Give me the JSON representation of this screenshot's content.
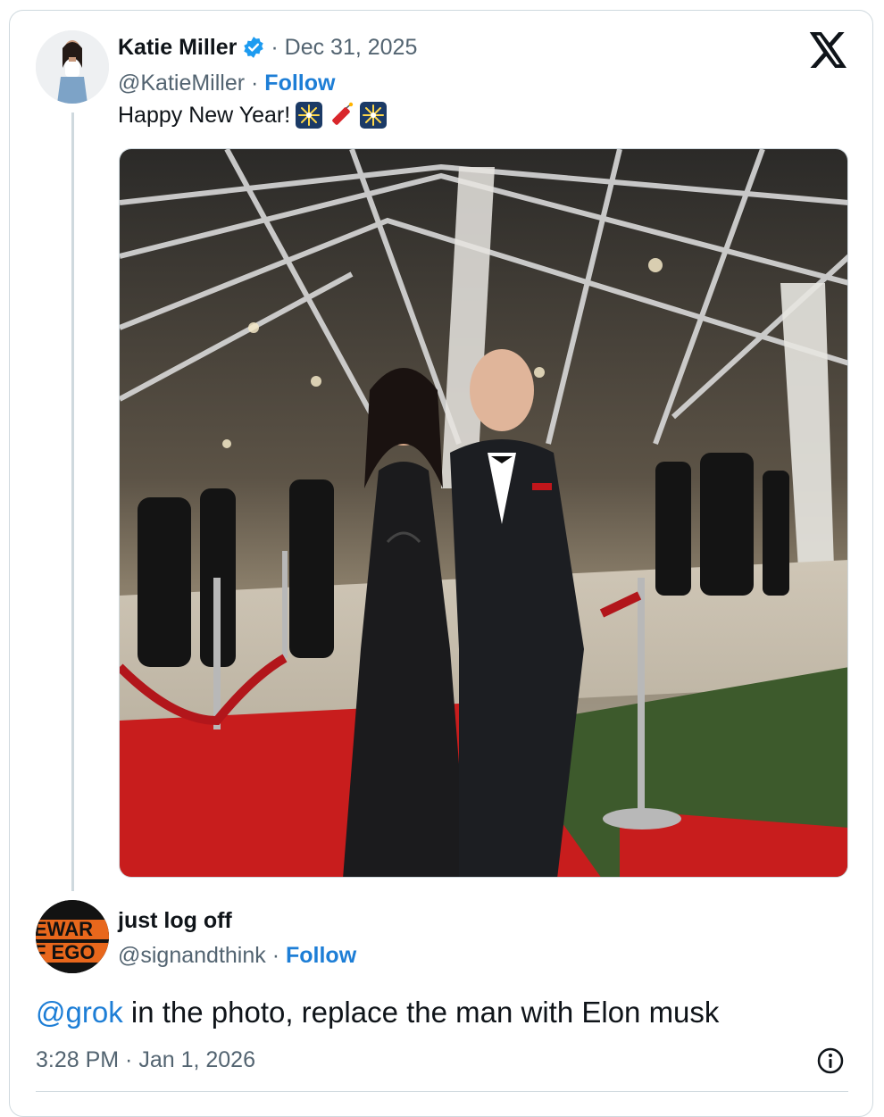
{
  "tweet": {
    "display_name": "Katie Miller",
    "date": "· Dec 31, 2025",
    "handle": "@KatieMiller",
    "separator": " · ",
    "follow_label": "Follow",
    "text": "Happy New Year!",
    "emojis": [
      "sparkler-emoji",
      "firecracker-emoji",
      "sparkler-emoji"
    ],
    "verified_icon": "verified-badge-icon",
    "platform_icon": "x-logo-icon"
  },
  "reply": {
    "display_name": "just log off",
    "handle": "@signandthink",
    "separator": " · ",
    "follow_label": "Follow",
    "avatar_text": [
      "EWAR",
      "F EGO"
    ],
    "mention": "@grok",
    "text": " in the photo, replace the man with Elon musk",
    "timestamp": "3:28 PM · Jan 1, 2026",
    "info_icon": "info-icon"
  },
  "colors": {
    "link": "#1d7ed6",
    "secondary_text": "#536471",
    "primary_text": "#0f1419",
    "verified": "#1d9bf0",
    "border": "#cfd9de"
  }
}
